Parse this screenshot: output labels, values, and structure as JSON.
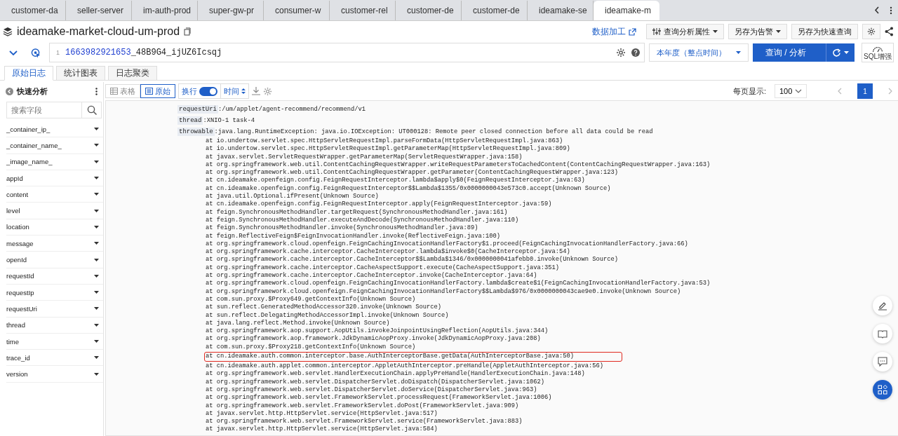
{
  "browser_tabs": [
    {
      "label": "customer-da",
      "selected": false
    },
    {
      "label": "seller-server",
      "selected": false
    },
    {
      "label": "im-auth-prod",
      "selected": false
    },
    {
      "label": "super-gw-pr",
      "selected": false
    },
    {
      "label": "consumer-w",
      "selected": false
    },
    {
      "label": "customer-rel",
      "selected": false
    },
    {
      "label": "customer-de",
      "selected": false
    },
    {
      "label": "customer-de",
      "selected": false
    },
    {
      "label": "ideamake-se",
      "selected": false
    },
    {
      "label": "ideamake-m",
      "selected": true
    }
  ],
  "header": {
    "title": "ideamake-market-cloud-um-prod",
    "actions": [
      {
        "label": "数据加工",
        "kind": "link"
      },
      {
        "label": "查询分析属性",
        "kind": "menu"
      },
      {
        "label": "另存为告警",
        "kind": "menu"
      },
      {
        "label": "另存为快速查询",
        "kind": "button"
      }
    ]
  },
  "query": {
    "line_number": "1",
    "tokens": [
      {
        "text": "1663982921653",
        "kind": "number"
      },
      {
        "text": "_48B9G4_ijUZ6Icsqj",
        "kind": "plain"
      }
    ],
    "time_range": "本年度（整点时间）",
    "search_button": "查询 / 分析",
    "sql_badge": "SQL增强"
  },
  "view_tabs": [
    {
      "label": "原始日志",
      "selected": true
    },
    {
      "label": "统计图表",
      "selected": false
    },
    {
      "label": "日志聚类",
      "selected": false
    }
  ],
  "sidebar": {
    "title": "快速分析",
    "search_placeholder": "搜索字段",
    "fields": [
      "_container_ip_",
      "_container_name_",
      "_image_name_",
      "appId",
      "content",
      "level",
      "location",
      "message",
      "openId",
      "requestId",
      "requestIp",
      "requestUri",
      "thread",
      "time",
      "trace_id",
      "version"
    ]
  },
  "toolbar": {
    "modes": [
      {
        "label": "表格",
        "selected": false
      },
      {
        "label": "原始",
        "selected": true
      }
    ],
    "wrap": {
      "label": "换行",
      "on": true
    },
    "sort": "时间",
    "page_size_label": "每页显示:",
    "page_size": "100",
    "pages": [
      {
        "label": "1",
        "selected": true
      }
    ]
  },
  "log": {
    "fields": [
      {
        "key": "requestUri",
        "value": ":/um/applet/agent-recommend/recommend/v1"
      },
      {
        "key": "thread",
        "value": ":XNIO-1 task-4"
      },
      {
        "key": "throwable",
        "value": ":java.lang.RuntimeException: java.io.IOException: UT000128: Remote peer closed connection before all data could be read"
      }
    ],
    "stack": [
      {
        "text": "at io.undertow.servlet.spec.HttpServletRequestImpl.parseFormData(HttpServletRequestImpl.java:863)",
        "highlighted": false
      },
      {
        "text": "at io.undertow.servlet.spec.HttpServletRequestImpl.getParameterMap(HttpServletRequestImpl.java:809)",
        "highlighted": false
      },
      {
        "text": "at javax.servlet.ServletRequestWrapper.getParameterMap(ServletRequestWrapper.java:158)",
        "highlighted": false
      },
      {
        "text": "at org.springframework.web.util.ContentCachingRequestWrapper.writeRequestParametersToCachedContent(ContentCachingRequestWrapper.java:163)",
        "highlighted": false
      },
      {
        "text": "at org.springframework.web.util.ContentCachingRequestWrapper.getParameter(ContentCachingRequestWrapper.java:123)",
        "highlighted": false
      },
      {
        "text": "at cn.ideamake.openfeign.config.FeignRequestInterceptor.lambda$apply$0(FeignRequestInterceptor.java:63)",
        "highlighted": false
      },
      {
        "text": "at cn.ideamake.openfeign.config.FeignRequestInterceptor$$Lambda$1355/0x0000000043e573c0.accept(Unknown Source)",
        "highlighted": false
      },
      {
        "text": "at java.util.Optional.ifPresent(Unknown Source)",
        "highlighted": false
      },
      {
        "text": "at cn.ideamake.openfeign.config.FeignRequestInterceptor.apply(FeignRequestInterceptor.java:59)",
        "highlighted": false
      },
      {
        "text": "at feign.SynchronousMethodHandler.targetRequest(SynchronousMethodHandler.java:161)",
        "highlighted": false
      },
      {
        "text": "at feign.SynchronousMethodHandler.executeAndDecode(SynchronousMethodHandler.java:110)",
        "highlighted": false
      },
      {
        "text": "at feign.SynchronousMethodHandler.invoke(SynchronousMethodHandler.java:89)",
        "highlighted": false
      },
      {
        "text": "at feign.ReflectiveFeign$FeignInvocationHandler.invoke(ReflectiveFeign.java:100)",
        "highlighted": false
      },
      {
        "text": "at org.springframework.cloud.openfeign.FeignCachingInvocationHandlerFactory$1.proceed(FeignCachingInvocationHandlerFactory.java:66)",
        "highlighted": false
      },
      {
        "text": "at org.springframework.cache.interceptor.CacheInterceptor.lambda$invoke$0(CacheInterceptor.java:54)",
        "highlighted": false
      },
      {
        "text": "at org.springframework.cache.interceptor.CacheInterceptor$$Lambda$1346/0x0000000041afebb0.invoke(Unknown Source)",
        "highlighted": false
      },
      {
        "text": "at org.springframework.cache.interceptor.CacheAspectSupport.execute(CacheAspectSupport.java:351)",
        "highlighted": false
      },
      {
        "text": "at org.springframework.cache.interceptor.CacheInterceptor.invoke(CacheInterceptor.java:64)",
        "highlighted": false
      },
      {
        "text": "at org.springframework.cloud.openfeign.FeignCachingInvocationHandlerFactory.lambda$create$1(FeignCachingInvocationHandlerFactory.java:53)",
        "highlighted": false
      },
      {
        "text": "at org.springframework.cloud.openfeign.FeignCachingInvocationHandlerFactory$$Lambda$976/0x0000000043cae9e0.invoke(Unknown Source)",
        "highlighted": false
      },
      {
        "text": "at com.sun.proxy.$Proxy649.getContextInfo(Unknown Source)",
        "highlighted": false
      },
      {
        "text": "at sun.reflect.GeneratedMethodAccessor320.invoke(Unknown Source)",
        "highlighted": false
      },
      {
        "text": "at sun.reflect.DelegatingMethodAccessorImpl.invoke(Unknown Source)",
        "highlighted": false
      },
      {
        "text": "at java.lang.reflect.Method.invoke(Unknown Source)",
        "highlighted": false
      },
      {
        "text": "at org.springframework.aop.support.AopUtils.invokeJoinpointUsingReflection(AopUtils.java:344)",
        "highlighted": false
      },
      {
        "text": "at org.springframework.aop.framework.JdkDynamicAopProxy.invoke(JdkDynamicAopProxy.java:208)",
        "highlighted": false
      },
      {
        "text": "at com.sun.proxy.$Proxy218.getContextInfo(Unknown Source)",
        "highlighted": false
      },
      {
        "text": "at cn.ideamake.auth.common.interceptor.base.AuthInterceptorBase.getData(AuthInterceptorBase.java:50)",
        "highlighted": true
      },
      {
        "text": "at cn.ideamake.auth.applet.common.interceptor.AppletAuthInterceptor.preHandle(AppletAuthInterceptor.java:56)",
        "highlighted": false
      },
      {
        "text": "at org.springframework.web.servlet.HandlerExecutionChain.applyPreHandle(HandlerExecutionChain.java:148)",
        "highlighted": false
      },
      {
        "text": "at org.springframework.web.servlet.DispatcherServlet.doDispatch(DispatcherServlet.java:1062)",
        "highlighted": false
      },
      {
        "text": "at org.springframework.web.servlet.DispatcherServlet.doService(DispatcherServlet.java:963)",
        "highlighted": false
      },
      {
        "text": "at org.springframework.web.servlet.FrameworkServlet.processRequest(FrameworkServlet.java:1006)",
        "highlighted": false
      },
      {
        "text": "at org.springframework.web.servlet.FrameworkServlet.doPost(FrameworkServlet.java:909)",
        "highlighted": false
      },
      {
        "text": "at javax.servlet.http.HttpServlet.service(HttpServlet.java:517)",
        "highlighted": false
      },
      {
        "text": "at org.springframework.web.servlet.FrameworkServlet.service(FrameworkServlet.java:883)",
        "highlighted": false
      },
      {
        "text": "at javax.servlet.http.HttpServlet.service(HttpServlet.java:584)",
        "highlighted": false
      }
    ]
  }
}
